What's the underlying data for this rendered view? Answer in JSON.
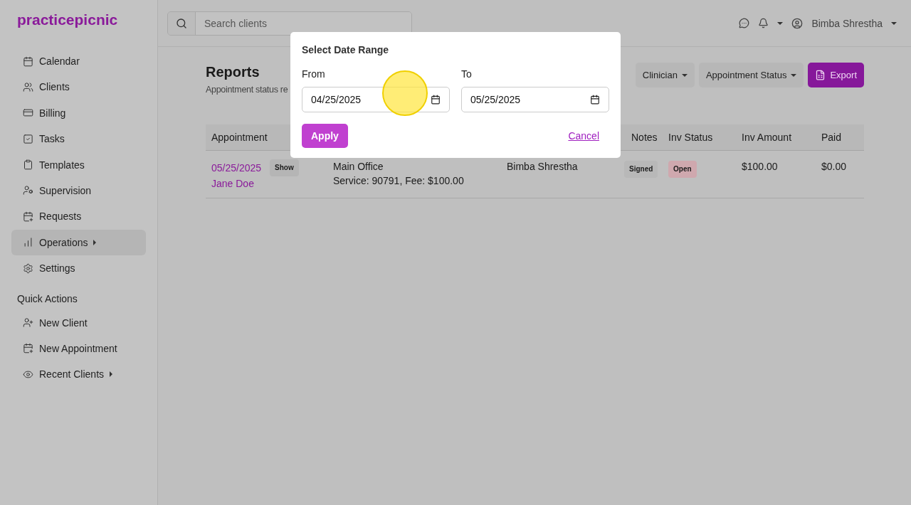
{
  "brand": "practicepicnic",
  "search": {
    "placeholder": "Search clients"
  },
  "user": {
    "name": "Bimba Shrestha"
  },
  "nav": [
    {
      "label": "Calendar",
      "selected": false,
      "submenu": false
    },
    {
      "label": "Clients",
      "selected": false,
      "submenu": false
    },
    {
      "label": "Billing",
      "selected": false,
      "submenu": false
    },
    {
      "label": "Tasks",
      "selected": false,
      "submenu": false
    },
    {
      "label": "Templates",
      "selected": false,
      "submenu": false
    },
    {
      "label": "Supervision",
      "selected": false,
      "submenu": false
    },
    {
      "label": "Requests",
      "selected": false,
      "submenu": false
    },
    {
      "label": "Operations",
      "selected": true,
      "submenu": true
    },
    {
      "label": "Settings",
      "selected": false,
      "submenu": false
    }
  ],
  "quick_actions": {
    "title": "Quick Actions",
    "items": [
      {
        "label": "New Client",
        "submenu": false
      },
      {
        "label": "New Appointment",
        "submenu": false
      },
      {
        "label": "Recent Clients",
        "submenu": true
      }
    ]
  },
  "page": {
    "title": "Reports",
    "subtitle": "Appointment status re"
  },
  "filters": [
    {
      "label": "Clinician",
      "kind": "dropdown"
    },
    {
      "label": "Appointment Status",
      "kind": "dropdown"
    },
    {
      "label": "Export",
      "kind": "primary"
    }
  ],
  "table": {
    "columns": [
      "Appointment",
      "Notes",
      "Inv Status",
      "Inv Amount",
      "Paid"
    ],
    "rows": [
      {
        "date": "05/25/2025",
        "status": "Show",
        "client": "Jane Doe",
        "location": "Main Office",
        "service": "Service: 90791, Fee: $100.00",
        "clinician": "Bimba Shrestha",
        "notes": "Signed",
        "inv_status": "Open",
        "inv_amount": "$100.00",
        "paid": "$0.00"
      }
    ]
  },
  "dialog": {
    "title": "Select Date Range",
    "from_label": "From",
    "from_value": "04/25/2025",
    "to_label": "To",
    "to_value": "05/25/2025",
    "apply": "Apply",
    "cancel": "Cancel"
  }
}
